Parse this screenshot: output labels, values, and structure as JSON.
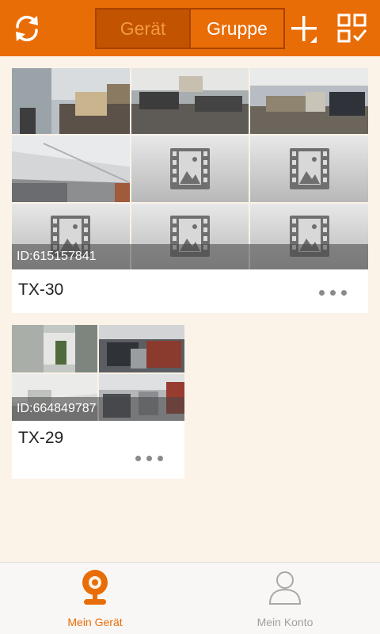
{
  "header": {
    "tabs": [
      {
        "label": "Gerät",
        "active": true
      },
      {
        "label": "Gruppe",
        "active": false
      }
    ],
    "icons": [
      "refresh-icon",
      "add-icon",
      "qr-scan-icon"
    ],
    "accent_color": "#e96d07"
  },
  "devices": [
    {
      "name": "TX-30",
      "id_text": "ID:615157841",
      "live_views": 4,
      "placeholder_views": 5
    },
    {
      "name": "TX-29",
      "id_text": "ID:664849787",
      "live_views": 4,
      "placeholder_views": 0
    }
  ],
  "bottom_nav": [
    {
      "label": "Mein Gerät",
      "icon": "camera-icon",
      "active": true
    },
    {
      "label": "Mein Konto",
      "icon": "user-icon",
      "active": false
    }
  ]
}
